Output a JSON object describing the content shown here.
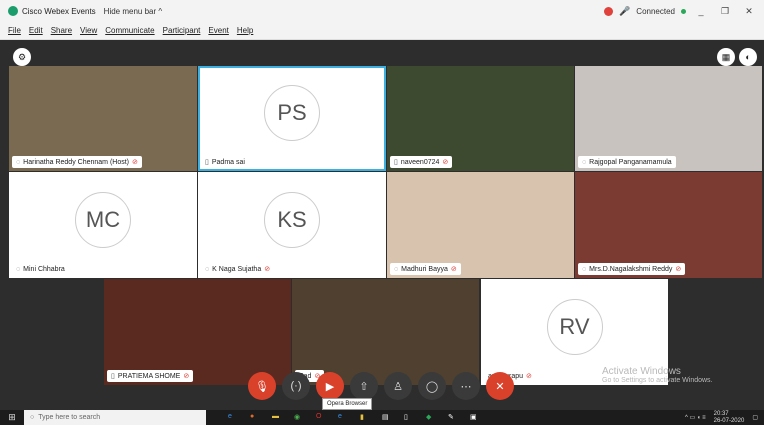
{
  "titlebar": {
    "title": "Cisco Webex Events",
    "hide": "Hide menu bar ^",
    "connected": "Connected",
    "minimize": "_",
    "restore": "❐",
    "close": "✕"
  },
  "menu": [
    "File",
    "Edit",
    "Share",
    "View",
    "Communicate",
    "Participant",
    "Event",
    "Help"
  ],
  "tiles": [
    {
      "name": "Harinatha Reddy Chennam (Host)",
      "initials": "",
      "camera": true
    },
    {
      "name": "Padma sai",
      "initials": "PS",
      "camera": false
    },
    {
      "name": "naveen0724",
      "initials": "",
      "camera": true
    },
    {
      "name": "Rajgopal Panganamamula",
      "initials": "",
      "camera": true
    },
    {
      "name": "Mini Chhabra",
      "initials": "MC",
      "camera": false
    },
    {
      "name": "K Naga Sujatha",
      "initials": "KS",
      "camera": false
    },
    {
      "name": "Madhuri Bayya",
      "initials": "",
      "camera": true
    },
    {
      "name": "Mrs.D.Nagalakshmi Reddy",
      "initials": "",
      "camera": true
    },
    {
      "name": "PRATIEMA SHOME",
      "initials": "",
      "camera": true
    },
    {
      "name": "Pad",
      "initials": "",
      "camera": true
    },
    {
      "name": "angipurapu",
      "initials": "RV",
      "camera": false
    }
  ],
  "tooltip": "Opera Browser",
  "activate": {
    "title": "Activate Windows",
    "sub": "Go to Settings to activate Windows."
  },
  "taskbar": {
    "search": "Type here to search",
    "time": "20:37",
    "date": "26-07-2020"
  }
}
